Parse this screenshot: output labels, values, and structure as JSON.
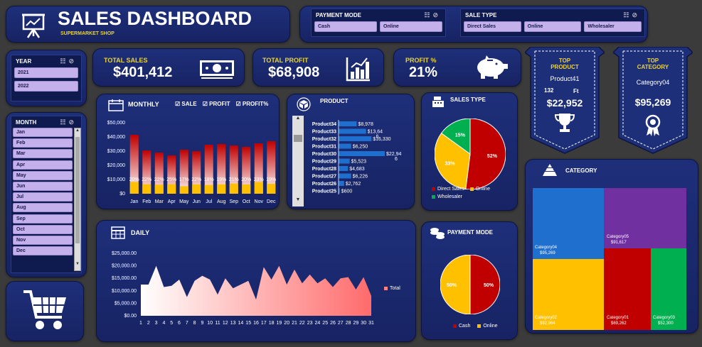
{
  "header": {
    "title": "SALES DASHBOARD",
    "subtitle": "SUPERMARKET SHOP"
  },
  "colors": {
    "panel": "#1b2a70",
    "slicer_button": "#c4b0ea",
    "yellow": "#e8d23a",
    "red": "#c00000",
    "orange": "#ffc000",
    "green": "#00b050",
    "blue": "#1f6fcf",
    "purple": "#7030a0"
  },
  "payment_slicer": {
    "title": "PAYMENT MODE",
    "options": [
      "Cash",
      "Online"
    ]
  },
  "saletype_slicer": {
    "title": "SALE TYPE",
    "options": [
      "Direct Sales",
      "Online",
      "Wholesaler"
    ]
  },
  "year_slicer": {
    "title": "YEAR",
    "options": [
      "2021",
      "2022"
    ]
  },
  "month_slicer": {
    "title": "MONTH",
    "options": [
      "Jan",
      "Feb",
      "Mar",
      "Apr",
      "May",
      "Jun",
      "Jul",
      "Aug",
      "Sep",
      "Oct",
      "Nov",
      "Dec"
    ]
  },
  "kpis": {
    "total_sales": {
      "label": "TOTAL SALES",
      "value": "$401,412",
      "icon": "money-icon"
    },
    "total_profit": {
      "label": "TOTAL PROFIT",
      "value": "$68,908",
      "icon": "bar-chart-icon"
    },
    "profit_pct": {
      "label": "PROFIT %",
      "value": "21%",
      "icon": "piggy-bank-icon"
    }
  },
  "top_product": {
    "label": "TOP PRODUCT",
    "name": "Product41",
    "qty": "132",
    "unit": "Ft",
    "value": "$22,952",
    "icon": "trophy-icon"
  },
  "top_category": {
    "label": "TOP CATEGORY",
    "name": "Category04",
    "value": "$95,269",
    "icon": "ribbon-icon"
  },
  "monthly": {
    "title": "MONTHLY",
    "legend": [
      "SALE",
      "PROFIT",
      "PROFIT%"
    ]
  },
  "product": {
    "title": "PRODUCT"
  },
  "sales_type": {
    "title": "SALES TYPE",
    "legend": [
      "Direct Sales",
      "Online",
      "Wholesaler"
    ]
  },
  "daily": {
    "title": "DAILY",
    "legend": "Total"
  },
  "payment_mode": {
    "title": "PAYMENT MODE",
    "legend": [
      "Cash",
      "Online"
    ]
  },
  "category": {
    "title": "CATEGORY"
  },
  "chart_data": [
    {
      "type": "bar",
      "name": "monthly",
      "categories": [
        "Jan",
        "Feb",
        "Mar",
        "Apr",
        "May",
        "Jun",
        "Jul",
        "Aug",
        "Sep",
        "Oct",
        "Nov",
        "Dec"
      ],
      "series": [
        {
          "name": "SALE",
          "values": [
            41500,
            30500,
            29000,
            27000,
            31000,
            30000,
            34500,
            35000,
            34000,
            33000,
            35500,
            37000
          ]
        },
        {
          "name": "PROFIT",
          "values": [
            8300,
            6700,
            6400,
            6750,
            5300,
            6600,
            6200,
            6650,
            7140,
            6600,
            8200,
            7000
          ]
        }
      ],
      "labels": [
        "20%",
        "22%",
        "22%",
        "25%",
        "17%",
        "22%",
        "18%",
        "19%",
        "21%",
        "20%",
        "23%",
        "19%"
      ],
      "yticks": [
        "$0",
        "$10,000",
        "$20,000",
        "$30,000",
        "$40,000",
        "$50,000"
      ],
      "ylim": [
        0,
        50000
      ]
    },
    {
      "type": "bar",
      "name": "product",
      "orientation": "horizontal",
      "categories": [
        "Product34",
        "Product33",
        "Product32",
        "Product31",
        "Product30",
        "Product29",
        "Product28",
        "Product27",
        "Product26",
        "Product25"
      ],
      "values": [
        8978,
        13646,
        16330,
        6250,
        22946,
        5523,
        4683,
        6226,
        2762,
        600
      ],
      "labels": [
        "$8,978",
        "$13,64\n6",
        "$16,330",
        "$6,250",
        "$22,94\n6",
        "$5,523",
        "$4,683",
        "$6,226",
        "$2,762",
        "$600"
      ]
    },
    {
      "type": "pie",
      "name": "sales_type",
      "categories": [
        "Direct Sales",
        "Online",
        "Wholesaler"
      ],
      "values": [
        52,
        33,
        15
      ],
      "labels": [
        "52%",
        "33%",
        "15%"
      ]
    },
    {
      "type": "area",
      "name": "daily",
      "x": [
        1,
        2,
        3,
        4,
        5,
        6,
        7,
        8,
        9,
        10,
        11,
        12,
        13,
        14,
        15,
        16,
        17,
        18,
        19,
        20,
        21,
        22,
        23,
        24,
        25,
        26,
        27,
        28,
        29,
        30,
        31
      ],
      "values": [
        12500,
        12500,
        20000,
        11500,
        12000,
        14500,
        7500,
        14000,
        16000,
        14500,
        8500,
        15000,
        11000,
        12500,
        14000,
        6500,
        19500,
        14500,
        20000,
        12500,
        18500,
        13000,
        16500,
        13000,
        15000,
        11500,
        15000,
        15500,
        10500,
        15500,
        8000
      ],
      "yticks": [
        "$0.00",
        "$5,000.00",
        "$10,000.00",
        "$15,000.00",
        "$20,000.00",
        "$25,000.00"
      ],
      "ylim": [
        0,
        25000
      ],
      "series_name": "Total"
    },
    {
      "type": "pie",
      "name": "payment_mode",
      "categories": [
        "Cash",
        "Online"
      ],
      "values": [
        50,
        50
      ],
      "labels": [
        "50%",
        "50%"
      ]
    },
    {
      "type": "treemap",
      "name": "category",
      "items": [
        {
          "name": "Category04",
          "value": "$95,269"
        },
        {
          "name": "Category05",
          "value": "$91,617"
        },
        {
          "name": "Category02",
          "value": "$92,964"
        },
        {
          "name": "Category01",
          "value": "$69,262"
        },
        {
          "name": "Category03",
          "value": "$52,300"
        }
      ]
    }
  ]
}
